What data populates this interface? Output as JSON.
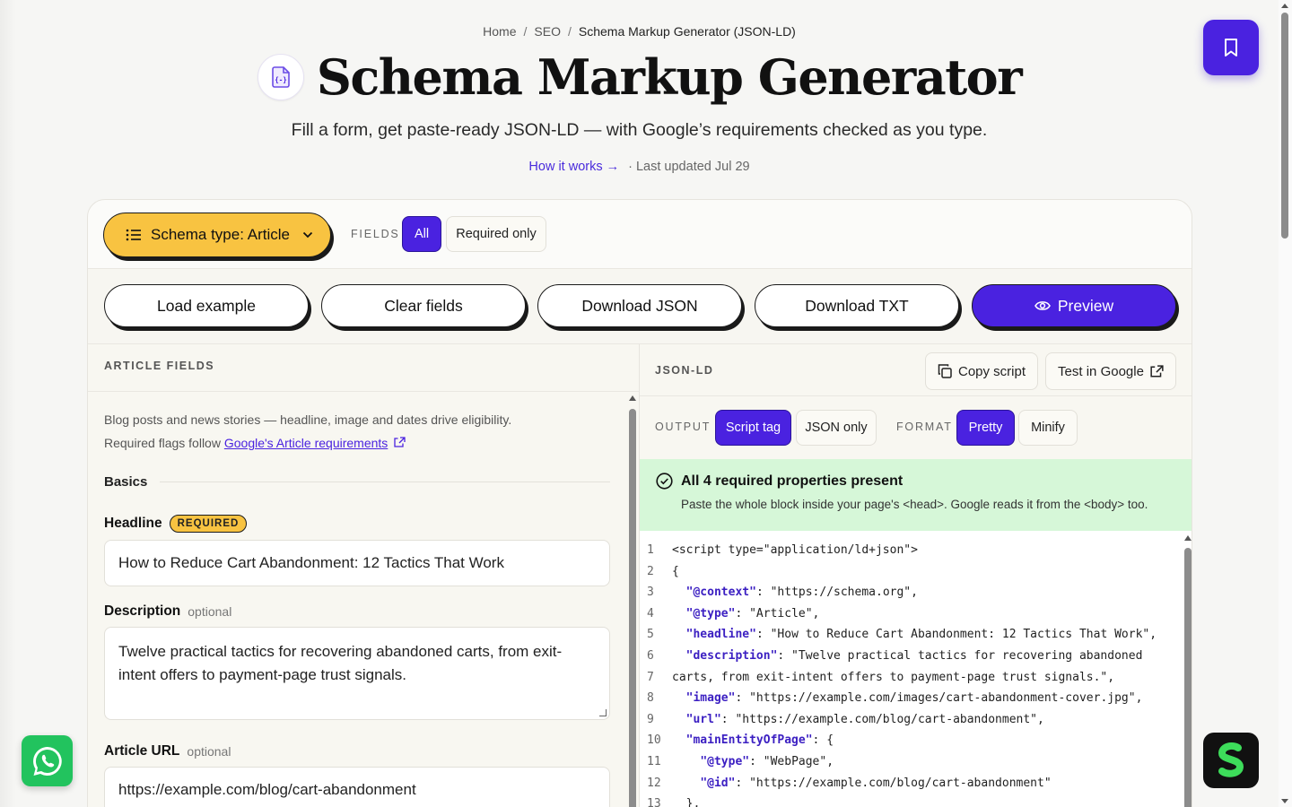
{
  "breadcrumb": {
    "home": "Home",
    "section": "SEO",
    "current": "Schema Markup Generator (JSON-LD)"
  },
  "header": {
    "title": "Schema Markup Generator",
    "subtitle": "Fill a form, get paste-ready JSON-LD — with Google’s requirements checked as you type.",
    "how_link": "How it works",
    "updated": "· Last updated Jul 29"
  },
  "toolbar": {
    "schema_select": "Schema type: Article",
    "fields_label": "FIELDS",
    "fields_all": "All",
    "fields_required": "Required only"
  },
  "actions": {
    "load_example": "Load example",
    "clear_fields": "Clear fields",
    "download_json": "Download JSON",
    "download_txt": "Download TXT",
    "preview": "Preview"
  },
  "left": {
    "heading": "ARTICLE FIELDS",
    "intro_line1": "Blog posts and news stories — headline, image and dates drive eligibility.",
    "intro_line2_prefix": "Required flags follow",
    "intro_link": "Google's Article requirements",
    "section": "Basics",
    "headline_label": "Headline",
    "required_badge": "REQUIRED",
    "headline_value": "How to Reduce Cart Abandonment: 12 Tactics That Work",
    "description_label": "Description",
    "optional": "optional",
    "description_value": "Twelve practical tactics for recovering abandoned carts, from exit-intent offers to payment-page trust signals.",
    "url_label": "Article URL",
    "url_value": "https://example.com/blog/cart-abandonment"
  },
  "right": {
    "heading": "JSON-LD",
    "copy_script": "Copy script",
    "test_google": "Test in Google",
    "output_label": "OUTPUT",
    "output_script": "Script tag",
    "output_json": "JSON only",
    "format_label": "FORMAT",
    "format_pretty": "Pretty",
    "format_minify": "Minify",
    "status_title": "All 4 required properties present",
    "status_sub": "Paste the whole block inside your page's <head>. Google reads it from the <body> too."
  },
  "code_lines": [
    {
      "n": "1",
      "pre": "<script type=\"application/ld+json\">",
      "key": "",
      "post": ""
    },
    {
      "n": "2",
      "pre": "{",
      "key": "",
      "post": ""
    },
    {
      "n": "3",
      "pre": "  ",
      "key": "\"@context\"",
      "post": ": \"https://schema.org\","
    },
    {
      "n": "4",
      "pre": "  ",
      "key": "\"@type\"",
      "post": ": \"Article\","
    },
    {
      "n": "5",
      "pre": "  ",
      "key": "\"headline\"",
      "post": ": \"How to Reduce Cart Abandonment: 12 Tactics That Work\","
    },
    {
      "n": "6",
      "pre": "  ",
      "key": "\"description\"",
      "post": ": \"Twelve practical tactics for recovering abandoned"
    },
    {
      "n": "7",
      "pre": "carts, from exit-intent offers to payment-page trust signals.\",",
      "key": "",
      "post": ""
    },
    {
      "n": "8",
      "pre": "  ",
      "key": "\"image\"",
      "post": ": \"https://example.com/images/cart-abandonment-cover.jpg\","
    },
    {
      "n": "9",
      "pre": "  ",
      "key": "\"url\"",
      "post": ": \"https://example.com/blog/cart-abandonment\","
    },
    {
      "n": "10",
      "pre": "  ",
      "key": "\"mainEntityOfPage\"",
      "post": ": {"
    },
    {
      "n": "11",
      "pre": "    ",
      "key": "\"@type\"",
      "post": ": \"WebPage\","
    },
    {
      "n": "12",
      "pre": "    ",
      "key": "\"@id\"",
      "post": ": \"https://example.com/blog/cart-abandonment\""
    },
    {
      "n": "13",
      "pre": "  },",
      "key": "",
      "post": ""
    }
  ],
  "colors": {
    "accent": "#4a22e0",
    "yellow": "#f8c341",
    "success_bg": "#d6f7d8",
    "whatsapp": "#22c35e"
  },
  "icons": [
    "document-code-icon",
    "bookmark-icon",
    "list-icon",
    "chevron-down-icon",
    "arrow-right-icon",
    "external-link-icon",
    "eye-icon",
    "copy-icon",
    "check-circle-icon",
    "whatsapp-icon",
    "brand-s-icon"
  ]
}
